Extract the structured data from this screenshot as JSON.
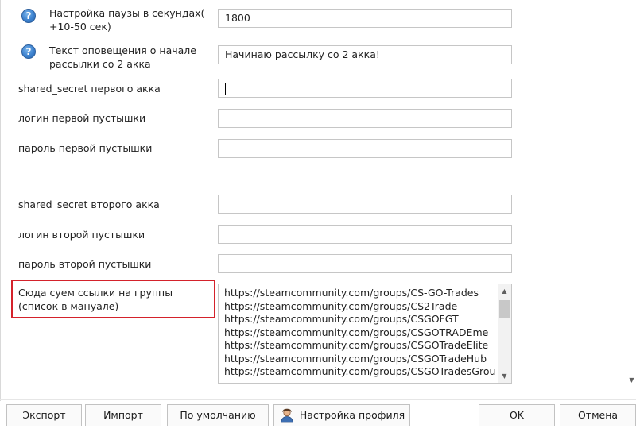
{
  "settings": {
    "pause": {
      "label": "Настройка паузы в секундах( +10-50 сек)",
      "value": "1800",
      "help_icon": "question-circle-icon"
    },
    "notify_text": {
      "label": "Текст оповещения о начале рассылки со 2 акка",
      "value": "Начинаю рассылку со 2 акка!",
      "help_icon": "question-circle-icon"
    },
    "shared_secret_1": {
      "label": "shared_secret первого акка",
      "value": ""
    },
    "login_1": {
      "label": "логин первой пустышки",
      "value": ""
    },
    "password_1": {
      "label": "пароль первой пустышки",
      "value": ""
    },
    "shared_secret_2": {
      "label": "shared_secret второго акка",
      "value": ""
    },
    "login_2": {
      "label": "логин второй пустышки",
      "value": ""
    },
    "password_2": {
      "label": "пароль второй пустышки",
      "value": ""
    },
    "groups": {
      "label": "Сюда суем ссылки на группы (список в мануале)",
      "lines": [
        "https://steamcommunity.com/groups/CS-GO-Trades",
        "https://steamcommunity.com/groups/CS2Trade",
        "https://steamcommunity.com/groups/CSGOFGT",
        "https://steamcommunity.com/groups/CSGOTRADEme",
        "https://steamcommunity.com/groups/CSGOTradeElite",
        "https://steamcommunity.com/groups/CSGOTradeHub",
        "https://steamcommunity.com/groups/CSGOTradesGrou"
      ]
    }
  },
  "buttons": {
    "export": "Экспорт",
    "import": "Импорт",
    "default": "По умолчанию",
    "profile": "Настройка профиля",
    "ok": "OK",
    "cancel": "Отмена"
  },
  "highlight_color": "#d4222b"
}
